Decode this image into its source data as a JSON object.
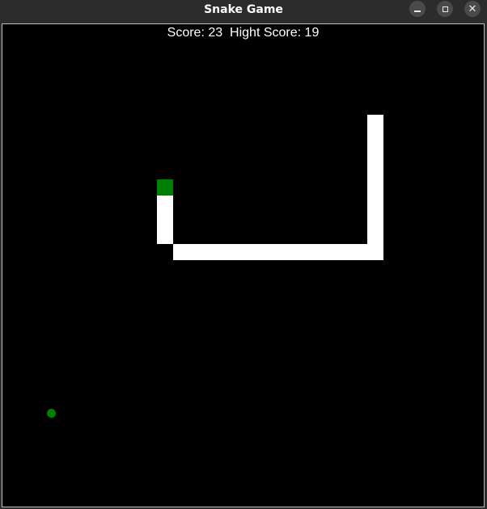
{
  "window": {
    "title": "Snake Game",
    "controls": {
      "minimize": "–",
      "maximize": "□",
      "close": "✕"
    }
  },
  "hud": {
    "score_label": "Score:",
    "score": "23",
    "high_score_label": "Hight Score:",
    "high_score": "19"
  },
  "colors": {
    "background": "#000000",
    "snake_body": "#ffffff",
    "snake_head": "#008000",
    "food": "#008000",
    "score_text": "#ffffff"
  },
  "game": {
    "grid_cell_size": 20,
    "snake": [
      {
        "col": 9,
        "row": 9
      },
      {
        "col": 9,
        "row": 10
      },
      {
        "col": 9,
        "row": 11
      },
      {
        "col": 9,
        "row": 12
      },
      {
        "col": 10,
        "row": 13
      },
      {
        "col": 11,
        "row": 13
      },
      {
        "col": 12,
        "row": 13
      },
      {
        "col": 13,
        "row": 13
      },
      {
        "col": 14,
        "row": 13
      },
      {
        "col": 15,
        "row": 13
      },
      {
        "col": 16,
        "row": 13
      },
      {
        "col": 17,
        "row": 13
      },
      {
        "col": 18,
        "row": 13
      },
      {
        "col": 19,
        "row": 13
      },
      {
        "col": 20,
        "row": 13
      },
      {
        "col": 22,
        "row": 13
      },
      {
        "col": 22,
        "row": 12
      },
      {
        "col": 22,
        "row": 11
      },
      {
        "col": 22,
        "row": 10
      },
      {
        "col": 22,
        "row": 9
      },
      {
        "col": 22,
        "row": 8
      },
      {
        "col": 22,
        "row": 7
      },
      {
        "col": 22,
        "row": 6
      },
      {
        "col": 22,
        "row": 5
      }
    ],
    "food": {
      "col": 2,
      "row": 23
    }
  }
}
